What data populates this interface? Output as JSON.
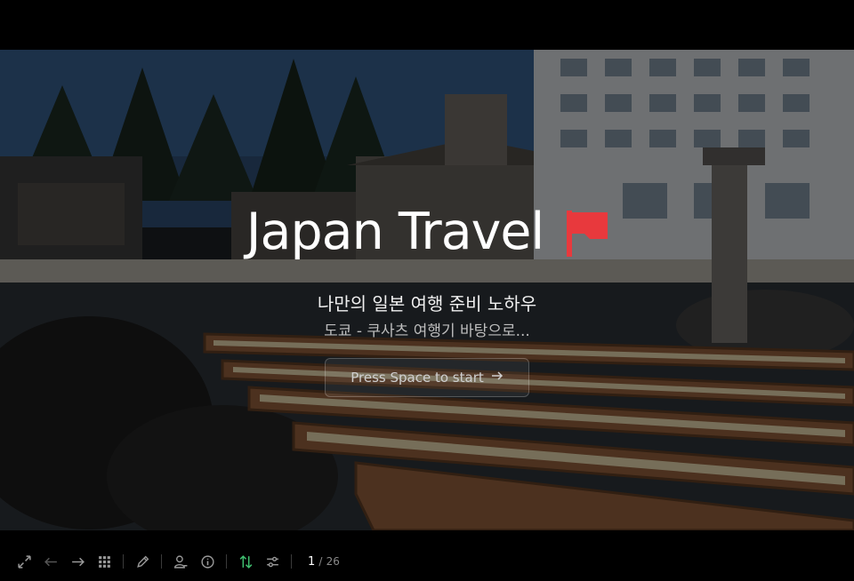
{
  "slide": {
    "title": "Japan Travel",
    "subtitle": "나만의 일본 여행 준비 노하우",
    "tagline": "도쿄 - 쿠사츠 여행기 바탕으로...",
    "start_label": "Press Space to start"
  },
  "pager": {
    "current": "1",
    "separator": "/",
    "total": "26"
  },
  "colors": {
    "flag": "#e8393d",
    "accent_green": "#3fbf6f",
    "toolbar_icon": "#9a9a9a"
  }
}
